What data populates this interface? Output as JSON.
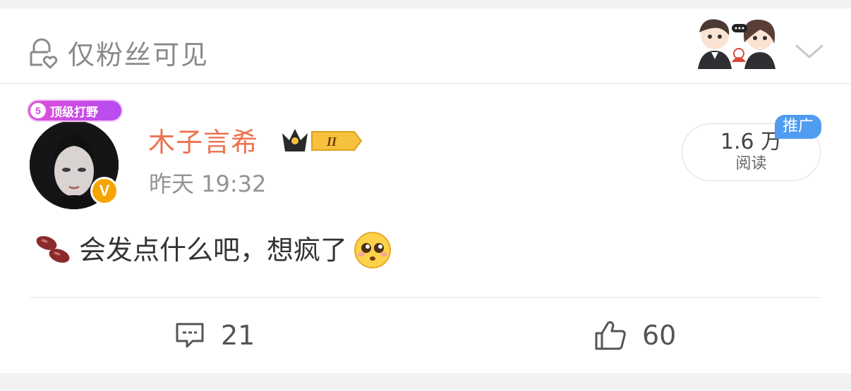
{
  "visibility": {
    "label": "仅粉丝可见",
    "icon": "lock-heart-icon"
  },
  "post": {
    "medal": {
      "level": "5",
      "text": "顶级打野"
    },
    "author": {
      "name": "木子言希",
      "vip_level": "II",
      "verified_badge": "V"
    },
    "time": "昨天 19:32",
    "reads": {
      "count": "1.6 万",
      "label": "阅读",
      "badge": "推广"
    },
    "content": {
      "text": "会发点什么吧，想疯了",
      "leading_icon": "beans-emoji",
      "trailing_icon": "pleading-face-emoji"
    }
  },
  "actions": {
    "comments": {
      "count": "21",
      "icon": "comment-icon"
    },
    "likes": {
      "count": "60",
      "icon": "thumbs-up-icon"
    }
  },
  "colors": {
    "username": "#eb7350",
    "promo": "#4f9cf0",
    "medal": "#c94bd8",
    "verified": "#f6a400"
  }
}
